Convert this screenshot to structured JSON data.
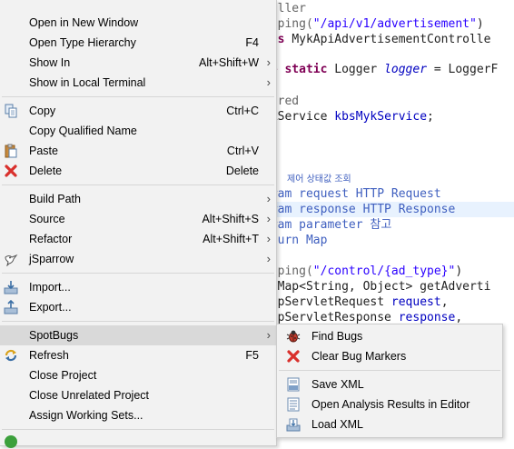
{
  "code": {
    "lines": [
      {
        "a": "roller"
      },
      {
        "b": "apping(",
        "s": "\"/api/v1/advertisement\"",
        "e": ")"
      },
      {
        "kw": "ass ",
        "t": "MykApiAdvertisementControlle"
      },
      {
        "kw": "te static ",
        "t": "Logger ",
        "it": "logger",
        "t2": " = LoggerF"
      },
      {
        "a": "wired"
      },
      {
        "t": "ykService ",
        "f": "kbsMykService",
        "t2": ";"
      },
      {
        "ko": "제어 상태값 조회"
      },
      {
        "doc": "aram request HTTP Request"
      },
      {
        "doc": "aram response HTTP Response"
      },
      {
        "doc": "aram parameter 참고"
      },
      {
        "doc": "eturn Map"
      },
      {
        "b": "apping(",
        "s": "\"/control/{ad_type}\"",
        "e": ")"
      },
      {
        "t": "c Map<String, Object> getAdverti"
      },
      {
        "t": "ttpServletRequest ",
        "f": "request",
        "t2": ","
      },
      {
        "t": "ttpServletResponse ",
        "f": "response",
        "t2": ","
      }
    ]
  },
  "context_menu": {
    "items": [
      {
        "label": "Open in New Window",
        "shortcut": "",
        "arrow": false,
        "icon": ""
      },
      {
        "label": "Open Type Hierarchy",
        "shortcut": "F4",
        "arrow": false,
        "icon": ""
      },
      {
        "label": "Show In",
        "shortcut": "Alt+Shift+W",
        "arrow": true,
        "icon": ""
      },
      {
        "label": "Show in Local Terminal",
        "shortcut": "",
        "arrow": true,
        "icon": ""
      },
      {
        "label": "Copy",
        "shortcut": "Ctrl+C",
        "arrow": false,
        "icon": "copy-icon"
      },
      {
        "label": "Copy Qualified Name",
        "shortcut": "",
        "arrow": false,
        "icon": "copy-qualified-name-icon"
      },
      {
        "label": "Paste",
        "shortcut": "Ctrl+V",
        "arrow": false,
        "icon": "paste-icon"
      },
      {
        "label": "Delete",
        "shortcut": "Delete",
        "arrow": false,
        "icon": "delete-icon"
      },
      {
        "label": "Build Path",
        "shortcut": "",
        "arrow": true,
        "icon": ""
      },
      {
        "label": "Source",
        "shortcut": "Alt+Shift+S",
        "arrow": true,
        "icon": ""
      },
      {
        "label": "Refactor",
        "shortcut": "Alt+Shift+T",
        "arrow": true,
        "icon": ""
      },
      {
        "label": "jSparrow",
        "shortcut": "",
        "arrow": true,
        "icon": "jsparrow-icon"
      },
      {
        "label": "Import...",
        "shortcut": "",
        "arrow": false,
        "icon": "import-icon"
      },
      {
        "label": "Export...",
        "shortcut": "",
        "arrow": false,
        "icon": "export-icon"
      },
      {
        "label": "SpotBugs",
        "shortcut": "",
        "arrow": true,
        "icon": ""
      },
      {
        "label": "Refresh",
        "shortcut": "F5",
        "arrow": false,
        "icon": "refresh-icon"
      },
      {
        "label": "Close Project",
        "shortcut": "",
        "arrow": false,
        "icon": ""
      },
      {
        "label": "Close Unrelated Project",
        "shortcut": "",
        "arrow": false,
        "icon": ""
      },
      {
        "label": "Assign Working Sets...",
        "shortcut": "",
        "arrow": false,
        "icon": ""
      }
    ]
  },
  "spotbugs_submenu": {
    "items": [
      {
        "label": "Find Bugs",
        "icon": "bug-icon"
      },
      {
        "label": "Clear Bug Markers",
        "icon": "clear-markers-icon"
      },
      {
        "label": "Save XML",
        "icon": "save-xml-icon"
      },
      {
        "label": "Open Analysis Results in Editor",
        "icon": "open-results-icon"
      },
      {
        "label": "Load XML",
        "icon": "load-xml-icon"
      }
    ]
  },
  "colors": {
    "menu_bg": "#f2f2f2",
    "hover_bg": "#d9d9d9",
    "delete_red": "#d9302c",
    "highlight_line": "#e8f2fe"
  }
}
